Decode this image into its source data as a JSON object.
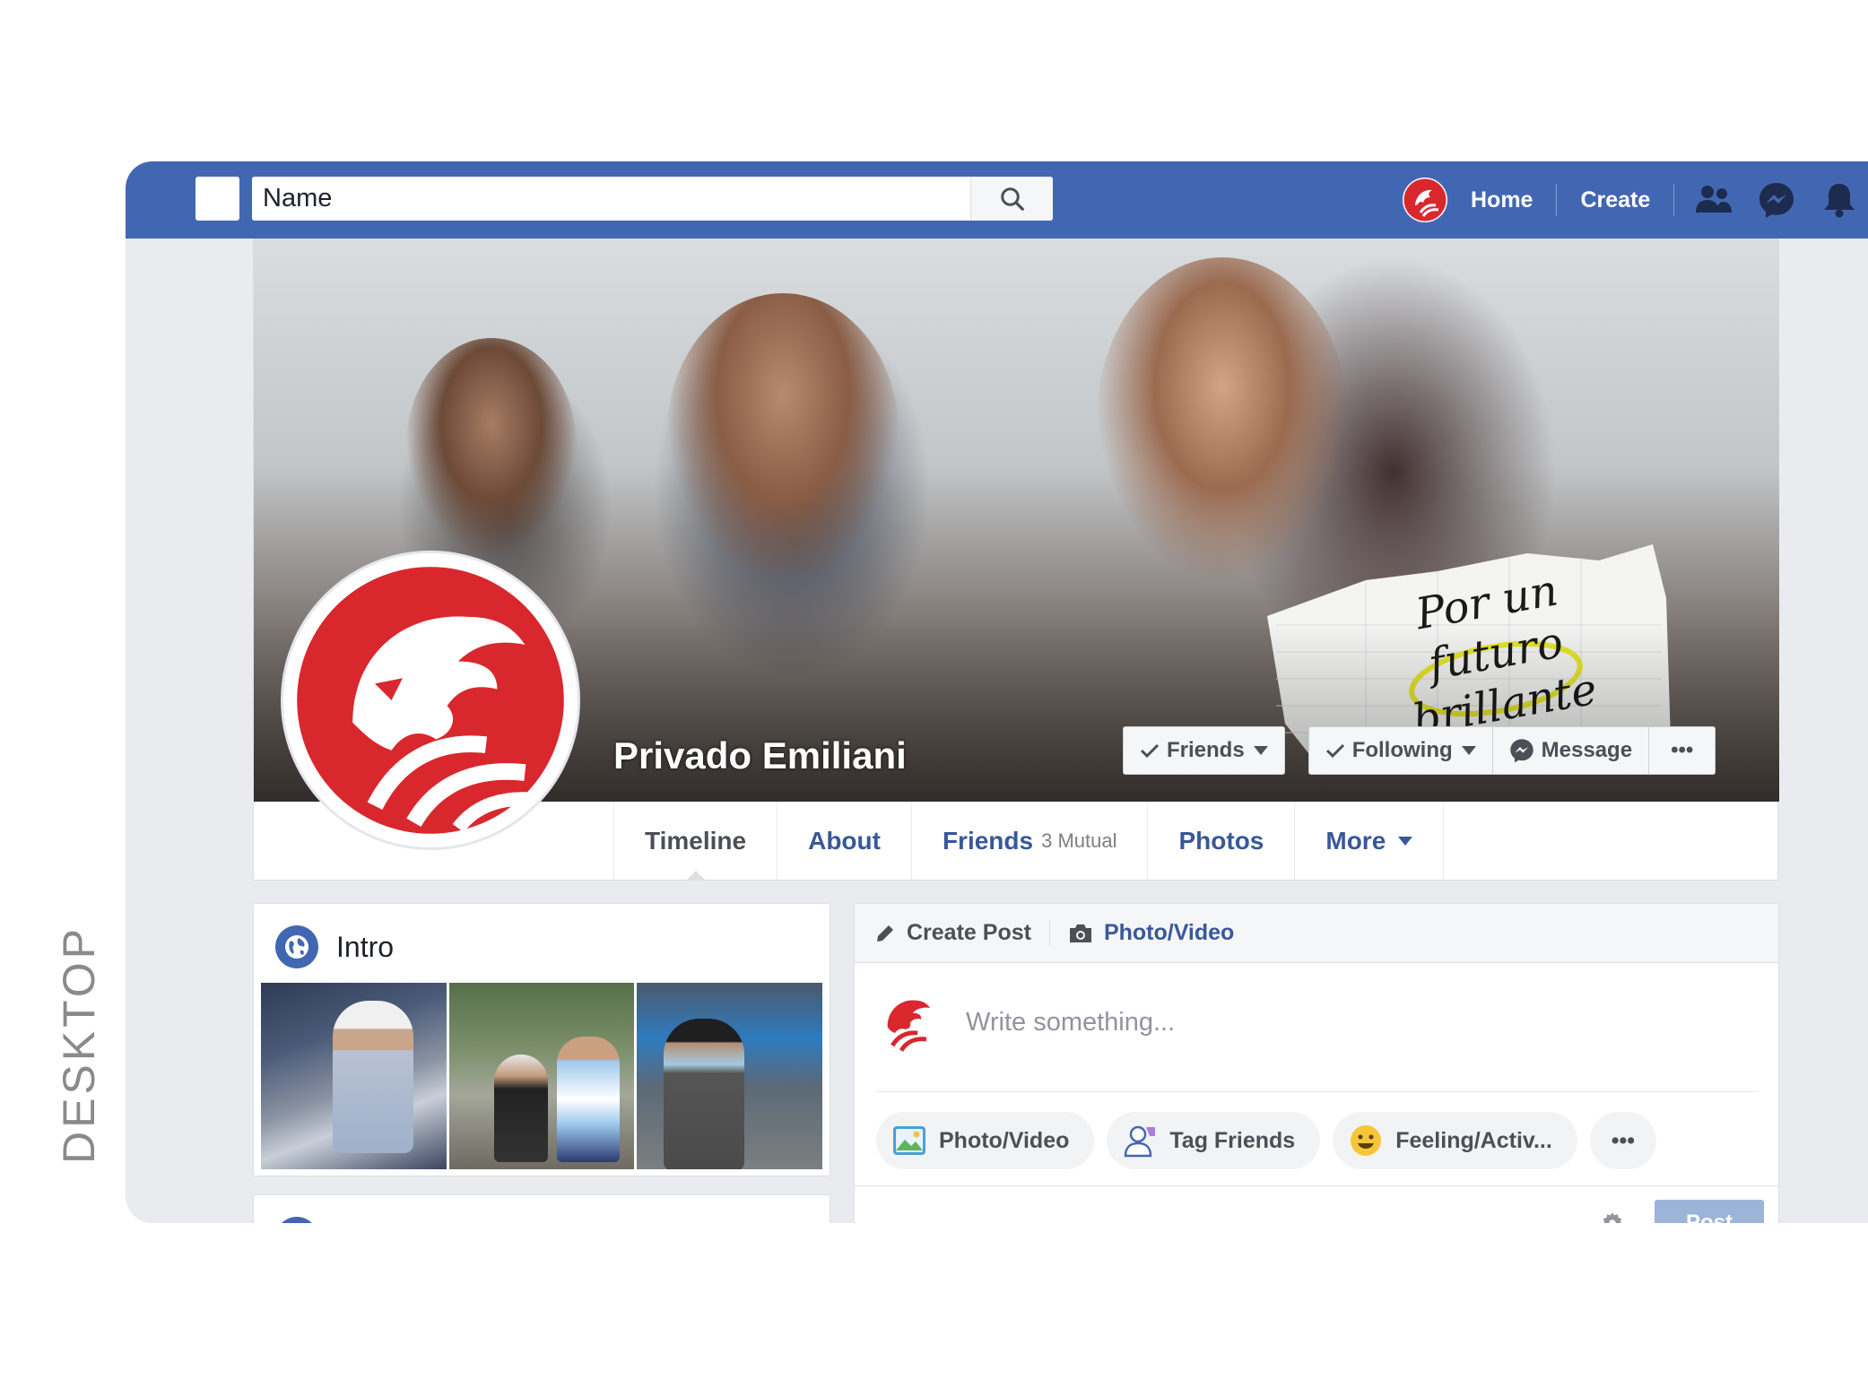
{
  "side_label": "DESKTOP",
  "topbar": {
    "search_value": "Name",
    "search_icon": "magnifier-icon",
    "nav": {
      "home_label": "Home",
      "create_label": "Create"
    },
    "icons": [
      "friend-requests-icon",
      "messenger-icon",
      "notifications-bell-icon"
    ]
  },
  "cover": {
    "note_text": "Por un futuro brillante"
  },
  "profile": {
    "name": "Privado Emiliani",
    "buttons": {
      "friends_label": "Friends",
      "following_label": "Following",
      "message_label": "Message",
      "more_label": "•••"
    },
    "tabs": [
      {
        "label": "Timeline"
      },
      {
        "label": "About"
      },
      {
        "label": "Friends",
        "sub": "3 Mutual"
      },
      {
        "label": "Photos"
      },
      {
        "label": "More"
      }
    ]
  },
  "intro": {
    "title": "Intro"
  },
  "composer": {
    "tab_create": "Create Post",
    "tab_photo": "Photo/Video",
    "placeholder": "Write something...",
    "actions": [
      {
        "label": "Photo/Video"
      },
      {
        "label": "Tag Friends"
      },
      {
        "label": "Feeling/Activ..."
      },
      {
        "label": "•••"
      }
    ],
    "post_label": "Post"
  },
  "colors": {
    "brand_blue": "#4267b2",
    "link_blue": "#385898",
    "logo_red": "#d9272e",
    "background": "#e9ebee"
  }
}
